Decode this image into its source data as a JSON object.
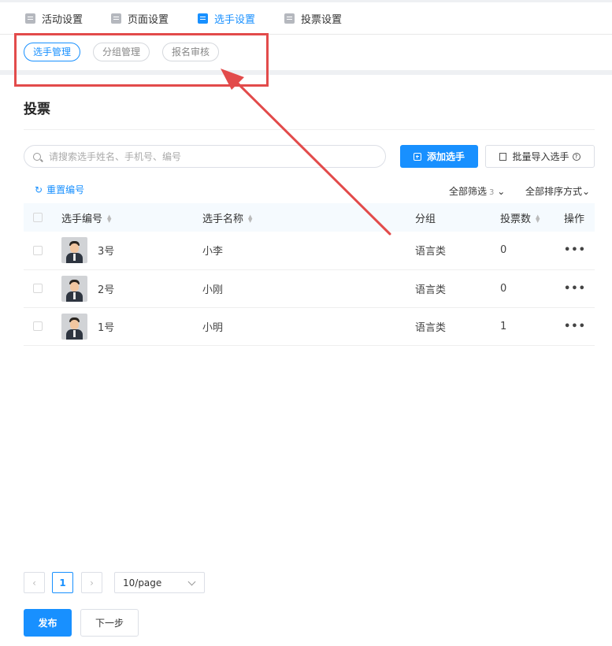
{
  "top_tabs": [
    {
      "label": "活动设置",
      "icon": "calendar-icon",
      "active": false
    },
    {
      "label": "页面设置",
      "icon": "page-icon",
      "active": false
    },
    {
      "label": "选手设置",
      "icon": "contestant-icon",
      "active": true
    },
    {
      "label": "投票设置",
      "icon": "vote-icon",
      "active": false
    }
  ],
  "sub_tabs": [
    {
      "label": "选手管理",
      "active": true
    },
    {
      "label": "分组管理",
      "active": false
    },
    {
      "label": "报名审核",
      "active": false
    }
  ],
  "section_title": "投票",
  "search": {
    "placeholder": "请搜索选手姓名、手机号、编号"
  },
  "toolbar": {
    "add_label": "添加选手",
    "import_label": "批量导入选手",
    "reset_label": "重置编号",
    "filter_label": "全部筛选",
    "filter_count": "3",
    "sort_label": "全部排序方式"
  },
  "table": {
    "headers": [
      "选手编号",
      "选手名称",
      "分组",
      "投票数",
      "操作"
    ],
    "rows": [
      {
        "number": "3号",
        "name": "小李",
        "group": "语言类",
        "votes": "0",
        "action": "•••"
      },
      {
        "number": "2号",
        "name": "小刚",
        "group": "语言类",
        "votes": "0",
        "action": "•••"
      },
      {
        "number": "1号",
        "name": "小明",
        "group": "语言类",
        "votes": "1",
        "action": "•••"
      }
    ]
  },
  "pagination": {
    "prev": "‹",
    "current": "1",
    "next": "›",
    "page_size": "10/page"
  },
  "footer": {
    "publish_label": "发布",
    "next_label": "下一步"
  },
  "colors": {
    "accent": "#1890ff",
    "annotation": "#e24b4b"
  }
}
